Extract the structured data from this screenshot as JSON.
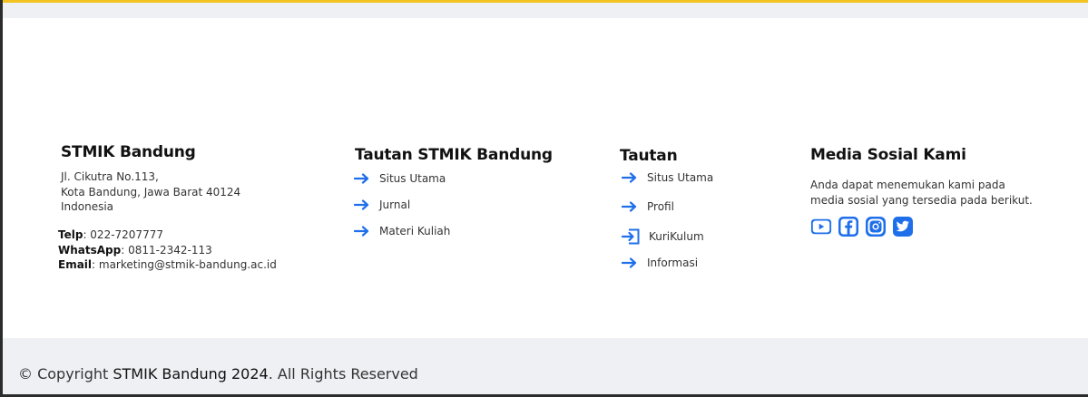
{
  "brand": {
    "title": "STMIK Bandung",
    "address": [
      "Jl. Cikutra No.113,",
      "Kota Bandung, Jawa Barat 40124",
      "Indonesia"
    ],
    "contacts": [
      {
        "label": "Telp",
        "value": ": 022-7207777"
      },
      {
        "label": "WhatsApp",
        "value": ": 0811-2342-113"
      },
      {
        "label": "Email",
        "value": ": marketing@stmik-bandung.ac.id"
      }
    ]
  },
  "links_stmik": {
    "title": "Tautan STMIK Bandung",
    "items": [
      "Situs Utama",
      "Jurnal",
      "Materi Kuliah"
    ]
  },
  "links": {
    "title": "Tautan",
    "items": [
      "Situs Utama",
      "Profil",
      "KuriKulum",
      "Informasi"
    ]
  },
  "social": {
    "title": "Media Sosial Kami",
    "description_lines": [
      "Anda dapat menemukan kami pada",
      "media sosial yang tersedia pada berikut."
    ],
    "icons": [
      "youtube-icon",
      "facebook-icon",
      "instagram-icon",
      "twitter-icon"
    ],
    "icon_color": "#1f6feb"
  },
  "footer": {
    "copyright_prefix": "© Copyright ",
    "copyright_brand": "STMIK Bandung 2024",
    "copyright_suffix": ". All Rights Reserved"
  },
  "colors": {
    "accent_top": "#f2c320",
    "link_arrow": "#1f6feb",
    "band": "#eef0f4"
  }
}
